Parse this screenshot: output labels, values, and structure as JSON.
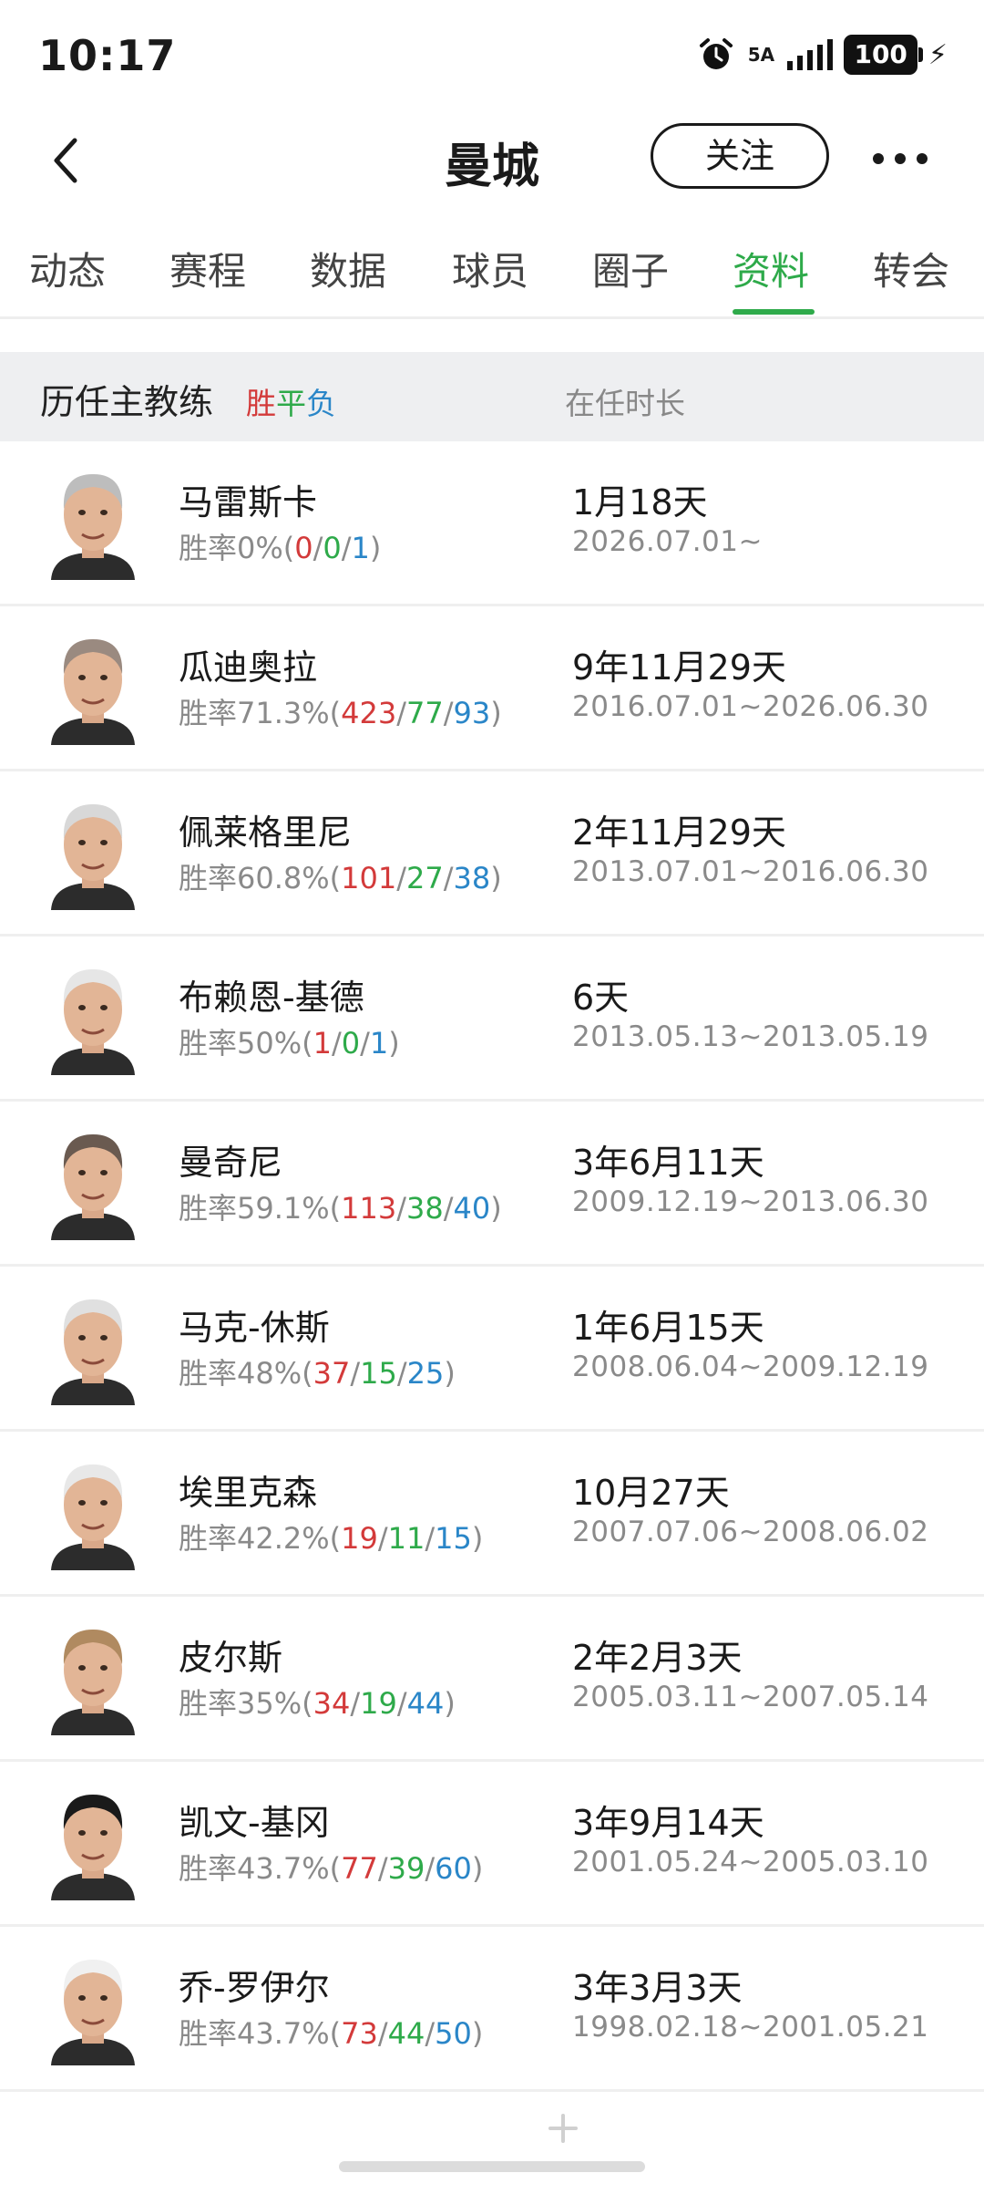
{
  "status_bar": {
    "time": "10:17",
    "network": "5A",
    "battery": "100"
  },
  "header": {
    "title": "曼城",
    "follow_label": "关注"
  },
  "tabs": [
    {
      "label": "动态"
    },
    {
      "label": "赛程"
    },
    {
      "label": "数据"
    },
    {
      "label": "球员"
    },
    {
      "label": "圈子"
    },
    {
      "label": "资料",
      "active": true
    },
    {
      "label": "转会"
    }
  ],
  "colors": {
    "accent": "#2eaa4a",
    "win": "#d33a3a",
    "draw": "#2eaa4a",
    "loss": "#2a86c8"
  },
  "section": {
    "title": "历任主教练",
    "legend_win": "胜",
    "legend_draw": "平",
    "legend_loss": "负",
    "duration_header": "在任时长"
  },
  "coaches": [
    {
      "name": "马雷斯卡",
      "win_rate": "胜率0%",
      "wins": "0",
      "draws": "0",
      "losses": "1",
      "tenure": "1月18天",
      "period": "2026.07.01~"
    },
    {
      "name": "瓜迪奥拉",
      "win_rate": "胜率71.3%",
      "wins": "423",
      "draws": "77",
      "losses": "93",
      "tenure": "9年11月29天",
      "period": "2016.07.01~2026.06.30"
    },
    {
      "name": "佩莱格里尼",
      "win_rate": "胜率60.8%",
      "wins": "101",
      "draws": "27",
      "losses": "38",
      "tenure": "2年11月29天",
      "period": "2013.07.01~2016.06.30"
    },
    {
      "name": "布赖恩-基德",
      "win_rate": "胜率50%",
      "wins": "1",
      "draws": "0",
      "losses": "1",
      "tenure": "6天",
      "period": "2013.05.13~2013.05.19"
    },
    {
      "name": "曼奇尼",
      "win_rate": "胜率59.1%",
      "wins": "113",
      "draws": "38",
      "losses": "40",
      "tenure": "3年6月11天",
      "period": "2009.12.19~2013.06.30"
    },
    {
      "name": "马克-休斯",
      "win_rate": "胜率48%",
      "wins": "37",
      "draws": "15",
      "losses": "25",
      "tenure": "1年6月15天",
      "period": "2008.06.04~2009.12.19"
    },
    {
      "name": "埃里克森",
      "win_rate": "胜率42.2%",
      "wins": "19",
      "draws": "11",
      "losses": "15",
      "tenure": "10月27天",
      "period": "2007.07.06~2008.06.02"
    },
    {
      "name": "皮尔斯",
      "win_rate": "胜率35%",
      "wins": "34",
      "draws": "19",
      "losses": "44",
      "tenure": "2年2月3天",
      "period": "2005.03.11~2007.05.14"
    },
    {
      "name": "凯文-基冈",
      "win_rate": "胜率43.7%",
      "wins": "77",
      "draws": "39",
      "losses": "60",
      "tenure": "3年9月14天",
      "period": "2001.05.24~2005.03.10"
    },
    {
      "name": "乔-罗伊尔",
      "win_rate": "胜率43.7%",
      "wins": "73",
      "draws": "44",
      "losses": "50",
      "tenure": "3年3月3天",
      "period": "1998.02.18~2001.05.21"
    }
  ]
}
